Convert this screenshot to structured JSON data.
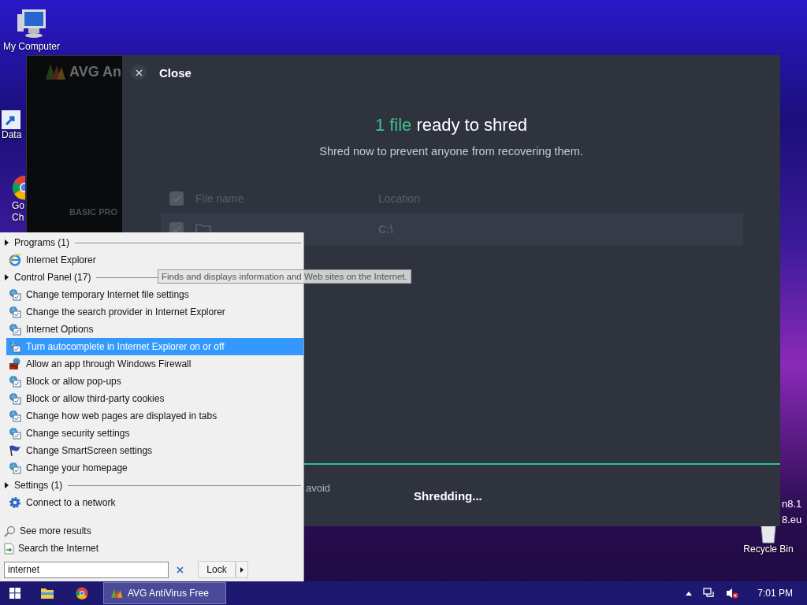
{
  "desktop": {
    "icons": [
      {
        "kind": "computer",
        "lines": [
          "My Computer"
        ]
      },
      {
        "kind": "shortcut",
        "lines": [
          "Data"
        ]
      },
      {
        "kind": "chrome",
        "lines": [
          "Go",
          "Ch"
        ]
      },
      {
        "kind": "bin",
        "lines": [
          "Recycle Bin"
        ]
      }
    ],
    "text_lines": [
      "n8.1",
      "8.eu"
    ]
  },
  "avg_window": {
    "logo_text": "AVG An",
    "sidebar_label": "BASIC PRO"
  },
  "shred_panel": {
    "close_label": "Close",
    "title_count": "1 file",
    "title_rest": "ready to shred",
    "subtitle": "Shred now to prevent anyone from recovering them.",
    "table": {
      "header_checked": true,
      "columns": [
        "File name",
        "Location"
      ],
      "rows": [
        {
          "checked": true,
          "location": "C:\\"
        }
      ]
    },
    "progress": {
      "level": 1
    },
    "hint_text": "avoid",
    "status": "Shredding..."
  },
  "start_menu": {
    "groups": [
      {
        "title": "Programs (1)",
        "items": [
          {
            "kind": "ie",
            "label": "Internet Explorer",
            "selected": false
          }
        ]
      },
      {
        "title": "Control Panel (17)",
        "items": [
          {
            "kind": "cpanel",
            "label": "Change temporary Internet file settings",
            "selected": false
          },
          {
            "kind": "cpanel",
            "label": "Change the search provider in Internet Explorer",
            "selected": false
          },
          {
            "kind": "cpanel",
            "label": "Internet Options",
            "selected": false
          },
          {
            "kind": "cpanel",
            "label": "Turn autocomplete in Internet Explorer on or off",
            "selected": true
          },
          {
            "kind": "firewall",
            "label": "Allow an app through Windows Firewall",
            "selected": false
          },
          {
            "kind": "cpanel",
            "label": "Block or allow pop-ups",
            "selected": false
          },
          {
            "kind": "cpanel",
            "label": "Block or allow third-party cookies",
            "selected": false
          },
          {
            "kind": "cpanel",
            "label": "Change how web pages are displayed in tabs",
            "selected": false
          },
          {
            "kind": "cpanel",
            "label": "Change security settings",
            "selected": false
          },
          {
            "kind": "flag",
            "label": "Change SmartScreen settings",
            "selected": false
          },
          {
            "kind": "cpanel",
            "label": "Change your homepage",
            "selected": false
          }
        ]
      },
      {
        "title": "Settings (1)",
        "items": [
          {
            "kind": "gear",
            "label": "Connect to a network",
            "selected": false
          }
        ]
      }
    ],
    "footer": [
      {
        "kind": "search",
        "label": "See more results"
      },
      {
        "kind": "web",
        "label": "Search the Internet"
      }
    ],
    "search": {
      "value": "internet"
    },
    "power_button": "Lock",
    "tooltip": "Finds and displays information and Web sites on the Internet."
  },
  "taskbar": {
    "pinned": [
      {
        "kind": "start"
      },
      {
        "kind": "explorer"
      },
      {
        "kind": "chrome"
      }
    ],
    "task": {
      "label": "AVG AntiVirus Free",
      "selected": true
    },
    "tray": [
      {
        "kind": "arrow"
      },
      {
        "kind": "network"
      },
      {
        "kind": "volume-muted"
      }
    ],
    "clock": "7:01 PM"
  }
}
